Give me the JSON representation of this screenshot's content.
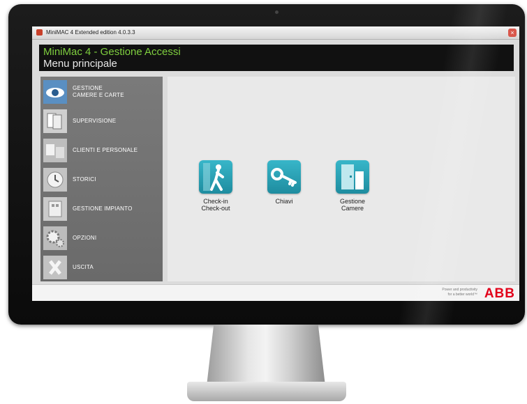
{
  "window": {
    "title": "MiniMAC 4 Extended edition 4.0.3.3",
    "close_glyph": "×"
  },
  "header": {
    "app_title": "MiniMac 4 - Gestione Accessi",
    "subtitle": "Menu principale"
  },
  "sidebar": {
    "items": [
      {
        "label": "GESTIONE\nCAMERE E CARTE",
        "icon": "eye-icon"
      },
      {
        "label": "SUPERVISIONE",
        "icon": "cards-icon"
      },
      {
        "label": "CLIENTI E PERSONALE",
        "icon": "people-icon"
      },
      {
        "label": "STORICI",
        "icon": "clock-icon"
      },
      {
        "label": "GESTIONE IMPIANTO",
        "icon": "building-icon"
      },
      {
        "label": "OPZIONI",
        "icon": "gear-icon"
      },
      {
        "label": "USCITA",
        "icon": "exit-icon"
      }
    ]
  },
  "main": {
    "tiles": [
      {
        "label": "Check-in\nCheck-out",
        "icon": "walking-person-icon"
      },
      {
        "label": "Chiavi",
        "icon": "keys-icon"
      },
      {
        "label": "Gestione\nCamere",
        "icon": "door-icon"
      }
    ]
  },
  "footer": {
    "tagline": "Power and productivity\nfor a better world™",
    "brand": "ABB"
  },
  "colors": {
    "header_green": "#7fcf3f",
    "tile_teal": "#2aa3b7",
    "brand_red": "#e2001a"
  }
}
